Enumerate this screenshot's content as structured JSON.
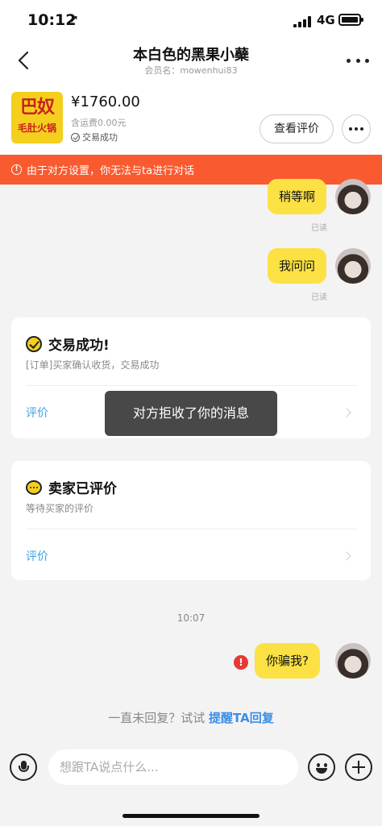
{
  "status": {
    "time": "10:12",
    "network": "4G"
  },
  "nav": {
    "title": "本白色的黑果小蘗",
    "member": "会员名：mowenhui83"
  },
  "order": {
    "logo_big": "巴奴",
    "logo_small": "毛肚火锅",
    "price": "¥1760.00",
    "shipping": "含运费0.00元",
    "status": "交易成功",
    "review_button": "查看评价"
  },
  "warning": {
    "icon": "!",
    "text": "由于对方设置，你无法与ta进行对话"
  },
  "messages": [
    {
      "text": "稍等啊",
      "read": "已读"
    },
    {
      "text": "我问问",
      "read": "已读"
    }
  ],
  "card_trade": {
    "title": "交易成功!",
    "desc": "[订单]买家确认收货，交易成功",
    "action": "评价"
  },
  "card_review": {
    "title": "卖家已评价",
    "desc": "等待买家的评价",
    "action": "评价"
  },
  "toast": "对方拒收了你的消息",
  "timestamp": "10:07",
  "last_message": {
    "text": "你骗我?",
    "error_badge": "!"
  },
  "no_reply": {
    "prefix": "一直未回复？试试 ",
    "link": "提醒TA回复"
  },
  "input": {
    "placeholder": "想跟TA说点什么..."
  },
  "colors": {
    "accent_yellow": "#fbe144",
    "warning_orange": "#fa5a2f",
    "link_blue": "#3aa3e3",
    "error_red": "#e53935"
  }
}
